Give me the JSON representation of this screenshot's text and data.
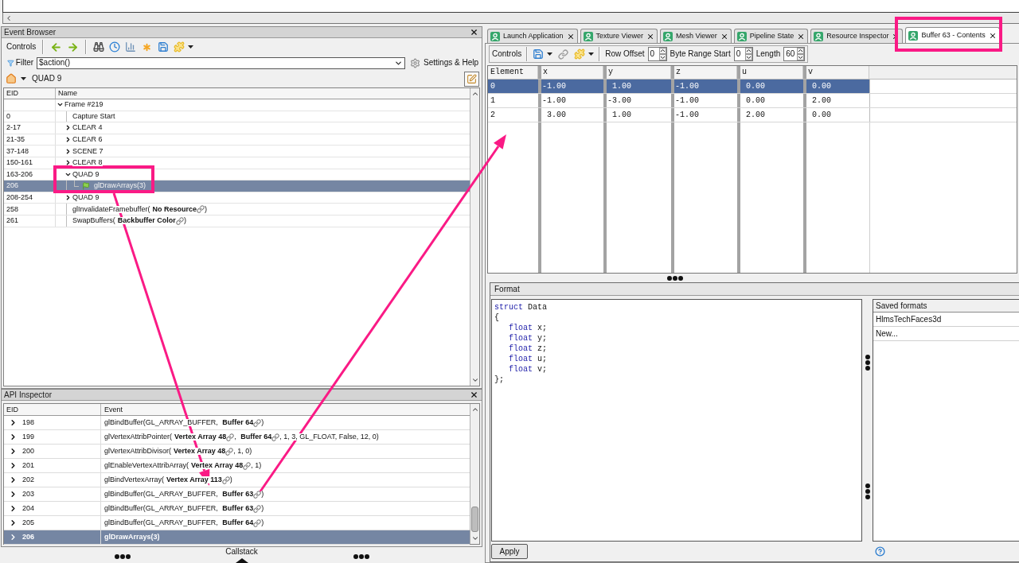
{
  "event_browser": {
    "title": "Event Browser",
    "toolbar_label": "Controls",
    "filter": {
      "label": "Filter",
      "value": "$action()"
    },
    "settings_button": "Settings & Help",
    "breadcrumb": "QUAD 9",
    "columns": [
      "EID",
      "Name"
    ],
    "rows": [
      {
        "kind": "group",
        "name": "Frame #219",
        "expanded": true,
        "selected": false,
        "children": [
          {
            "kind": "event",
            "eid": "0",
            "name": "Capture Start",
            "selected": false
          },
          {
            "kind": "group",
            "eid": "2-17",
            "name": "CLEAR 4",
            "expanded": false,
            "selected": false
          },
          {
            "kind": "group",
            "eid": "21-35",
            "name": "CLEAR 6",
            "expanded": false,
            "selected": false
          },
          {
            "kind": "group",
            "eid": "37-148",
            "name": "SCENE 7",
            "expanded": false,
            "selected": false
          },
          {
            "kind": "group",
            "eid": "150-161",
            "name": "CLEAR 8",
            "expanded": false,
            "selected": false
          },
          {
            "kind": "group",
            "eid": "163-206",
            "name": "QUAD 9",
            "expanded": true,
            "selected": false,
            "children": [
              {
                "kind": "event",
                "eid": "206",
                "name": "glDrawArrays(3)",
                "selected": true
              }
            ]
          },
          {
            "kind": "group",
            "eid": "208-254",
            "name": "QUAD 9",
            "expanded": false,
            "selected": false
          },
          {
            "kind": "event",
            "eid": "258",
            "parts": [
              {
                "kind": "text",
                "text": "glInvalidateFramebuffer("
              },
              {
                "kind": "resource",
                "text": "No Resource"
              },
              {
                "kind": "text",
                "text": ")"
              }
            ],
            "selected": false
          },
          {
            "kind": "event",
            "eid": "261",
            "parts": [
              {
                "kind": "text",
                "text": "SwapBuffers("
              },
              {
                "kind": "resource",
                "text": "Backbuffer Color"
              },
              {
                "kind": "text",
                "text": ")"
              }
            ],
            "selected": false
          }
        ]
      }
    ]
  },
  "api_inspector": {
    "title": "API Inspector",
    "columns": [
      "EID",
      "Event"
    ],
    "rows": [
      {
        "eid": "198",
        "expanded": false,
        "selected": false,
        "parts": [
          {
            "kind": "text",
            "text": "glBindBuffer(GL_ARRAY_BUFFER, "
          },
          {
            "kind": "resource",
            "text": "Buffer 64"
          },
          {
            "kind": "text",
            "text": ")"
          }
        ]
      },
      {
        "eid": "199",
        "expanded": false,
        "selected": false,
        "parts": [
          {
            "kind": "text",
            "text": "glVertexAttribPointer("
          },
          {
            "kind": "resource",
            "text": "Vertex Array 48"
          },
          {
            "kind": "text",
            "text": ", "
          },
          {
            "kind": "resource",
            "text": "Buffer 64"
          },
          {
            "kind": "text",
            "text": ", 1, 3, GL_FLOAT, False, 12, 0)"
          }
        ]
      },
      {
        "eid": "200",
        "expanded": false,
        "selected": false,
        "parts": [
          {
            "kind": "text",
            "text": "glVertexAttribDivisor("
          },
          {
            "kind": "resource",
            "text": "Vertex Array 48"
          },
          {
            "kind": "text",
            "text": ", 1, 0)"
          }
        ]
      },
      {
        "eid": "201",
        "expanded": false,
        "selected": false,
        "parts": [
          {
            "kind": "text",
            "text": "glEnableVertexAttribArray("
          },
          {
            "kind": "resource",
            "text": "Vertex Array 48"
          },
          {
            "kind": "text",
            "text": ", 1)"
          }
        ]
      },
      {
        "eid": "202",
        "expanded": false,
        "selected": false,
        "parts": [
          {
            "kind": "text",
            "text": "glBindVertexArray("
          },
          {
            "kind": "resource",
            "text": "Vertex Array 113"
          },
          {
            "kind": "text",
            "text": ")"
          }
        ]
      },
      {
        "eid": "203",
        "expanded": false,
        "selected": false,
        "parts": [
          {
            "kind": "text",
            "text": "glBindBuffer(GL_ARRAY_BUFFER, "
          },
          {
            "kind": "resource",
            "text": "Buffer 63"
          },
          {
            "kind": "text",
            "text": ")"
          }
        ]
      },
      {
        "eid": "204",
        "expanded": false,
        "selected": false,
        "parts": [
          {
            "kind": "text",
            "text": "glBindBuffer(GL_ARRAY_BUFFER, "
          },
          {
            "kind": "resource",
            "text": "Buffer 63"
          },
          {
            "kind": "text",
            "text": ")"
          }
        ]
      },
      {
        "eid": "205",
        "expanded": false,
        "selected": false,
        "parts": [
          {
            "kind": "text",
            "text": "glBindBuffer(GL_ARRAY_BUFFER, "
          },
          {
            "kind": "resource",
            "text": "Buffer 64"
          },
          {
            "kind": "text",
            "text": ")"
          }
        ]
      },
      {
        "eid": "206",
        "expanded": false,
        "selected": true,
        "parts": [
          {
            "kind": "text",
            "text": "glDrawArrays(3)"
          }
        ]
      }
    ]
  },
  "callstack_toggle": "Callstack",
  "tabs": [
    {
      "label": "Launch Application",
      "selected": false
    },
    {
      "label": "Texture Viewer",
      "selected": false
    },
    {
      "label": "Mesh Viewer",
      "selected": false
    },
    {
      "label": "Pipeline State",
      "selected": false
    },
    {
      "label": "Resource Inspector",
      "selected": false
    },
    {
      "label": "Buffer 63 - Contents",
      "selected": true
    }
  ],
  "buffer_viewer": {
    "toolbar": {
      "label": "Controls",
      "row_offset": {
        "label": "Row Offset",
        "value": "0"
      },
      "byte_range_start": {
        "label": "Byte Range Start",
        "value": "0"
      },
      "length": {
        "label": "Length",
        "value": "60"
      }
    },
    "table": {
      "columns": [
        "Element",
        "x",
        "y",
        "z",
        "u",
        "v"
      ],
      "rows": [
        {
          "cells": [
            "0",
            "-1.00",
            "1.00",
            "-1.00",
            "0.00",
            "0.00"
          ],
          "selected": true
        },
        {
          "cells": [
            "1",
            "-1.00",
            "-3.00",
            "-1.00",
            "0.00",
            "2.00"
          ],
          "selected": false
        },
        {
          "cells": [
            "2",
            "3.00",
            "1.00",
            "-1.00",
            "2.00",
            "0.00"
          ],
          "selected": false
        }
      ]
    },
    "format": {
      "title": "Format",
      "code": [
        [
          {
            "kind": "keyword",
            "text": "struct"
          },
          {
            "kind": "plain",
            "text": " Data"
          }
        ],
        [
          {
            "kind": "plain",
            "text": "{"
          }
        ],
        [
          {
            "kind": "keyword",
            "text": "   float"
          },
          {
            "kind": "plain",
            "text": " x;"
          }
        ],
        [
          {
            "kind": "keyword",
            "text": "   float"
          },
          {
            "kind": "plain",
            "text": " y;"
          }
        ],
        [
          {
            "kind": "keyword",
            "text": "   float"
          },
          {
            "kind": "plain",
            "text": " z;"
          }
        ],
        [
          {
            "kind": "keyword",
            "text": "   float"
          },
          {
            "kind": "plain",
            "text": " u;"
          }
        ],
        [
          {
            "kind": "keyword",
            "text": "   float"
          },
          {
            "kind": "plain",
            "text": " v;"
          }
        ],
        [
          {
            "kind": "plain",
            "text": "};"
          }
        ]
      ],
      "apply_button": "Apply"
    },
    "saved_formats": {
      "title": "Saved formats",
      "items": [
        {
          "label": "HlmsTechFaces3d",
          "selected": false
        },
        {
          "label": "New...",
          "selected": false
        }
      ]
    }
  }
}
